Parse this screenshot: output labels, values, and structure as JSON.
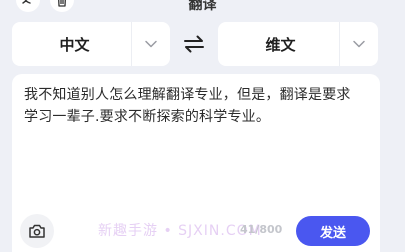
{
  "header": {
    "title": "翻译",
    "left_icons": [
      "translate-icon",
      "trash-icon"
    ]
  },
  "languages": {
    "source": "中文",
    "target": "维文",
    "swap_icon": "swap-icon",
    "dropdown_icon": "chevron-down-icon"
  },
  "input": {
    "text": "我不知道别人怎么理解翻译专业，但是，翻译是要求学习一辈子.要求不断探索的科学专业。",
    "char_count": "41/800",
    "watermark": "新趣手游 • SJXIN.COM"
  },
  "actions": {
    "camera_icon": "camera-icon",
    "send_label": "发送"
  },
  "colors": {
    "background": "#eef0f6",
    "accent": "#4a57f0",
    "card": "#ffffff"
  }
}
